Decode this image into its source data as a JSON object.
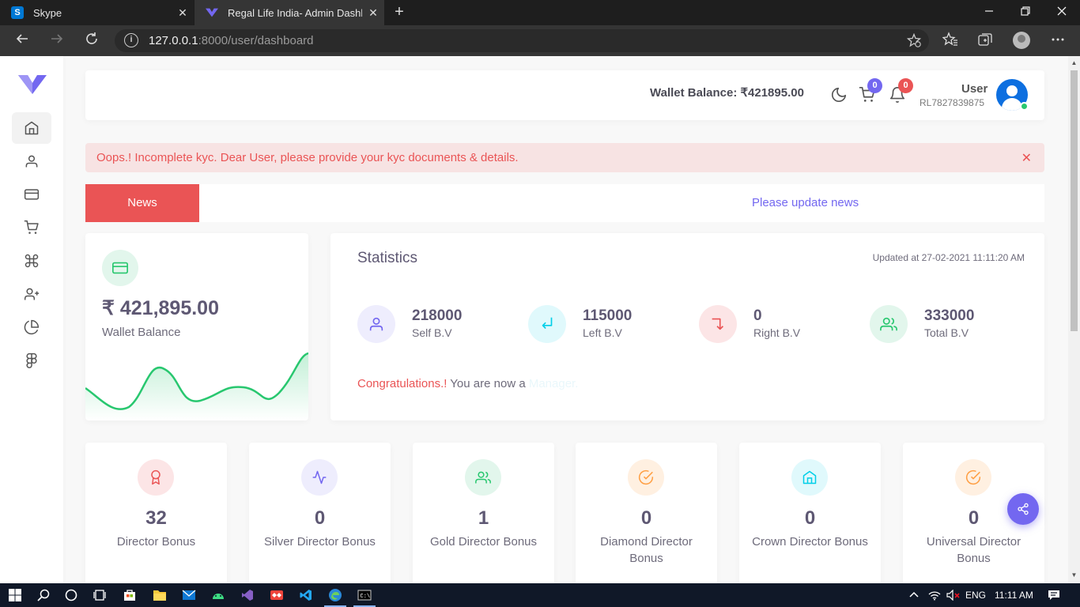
{
  "browser": {
    "tabs": [
      {
        "title": "Skype",
        "icon": "skype-icon",
        "color": "#0078d4"
      },
      {
        "title": "Regal Life India- Admin Dashboa",
        "icon": "vuexy-logo-icon",
        "color": "#7367f0"
      }
    ],
    "close_glyph": "✕",
    "new_tab_glyph": "+",
    "url_host": "127.0.0.1",
    "url_rest": ":8000/user/dashboard",
    "window_controls": [
      "minimize-icon",
      "restore-icon",
      "close-icon"
    ]
  },
  "sidebar": {
    "items": [
      "home-icon",
      "user-icon",
      "credit-card-icon",
      "cart-icon",
      "command-icon",
      "user-plus-icon",
      "pie-chart-icon",
      "figma-icon"
    ],
    "active_index": 0
  },
  "header": {
    "wallet_balance": "Wallet Balance: ₹421895.00",
    "cart_count": "0",
    "notification_count": "0",
    "user_name": "User",
    "user_id": "RL7827839875"
  },
  "alert": {
    "text": "Oops.! Incomplete kyc. Dear User, please provide your kyc documents & details.",
    "close": "✕"
  },
  "news": {
    "label": "News",
    "text": "Please update news"
  },
  "wallet_card": {
    "amount": "₹ 421,895.00",
    "label": "Wallet Balance"
  },
  "statistics": {
    "title": "Statistics",
    "updated": "Updated at 27-02-2021 11:11:20 AM",
    "items": [
      {
        "value": "218000",
        "label": "Self B.V",
        "icon": "user-icon"
      },
      {
        "value": "115000",
        "label": "Left B.V",
        "icon": "arrow-down-left-icon"
      },
      {
        "value": "0",
        "label": "Right B.V",
        "icon": "arrow-down-right-icon"
      },
      {
        "value": "333000",
        "label": "Total B.V",
        "icon": "users-icon"
      }
    ],
    "congrats_prefix": "Congratulations.!",
    "congrats_middle": " You are now a ",
    "congrats_rank": "Manager."
  },
  "bonuses": [
    {
      "value": "32",
      "label": "Director Bonus",
      "icon": "award-icon"
    },
    {
      "value": "0",
      "label": "Silver Director Bonus",
      "icon": "activity-icon"
    },
    {
      "value": "1",
      "label": "Gold Director Bonus",
      "icon": "users-icon"
    },
    {
      "value": "0",
      "label": "Diamond Director Bonus",
      "icon": "check-circle-icon"
    },
    {
      "value": "0",
      "label": "Crown Director Bonus",
      "icon": "home-icon"
    },
    {
      "value": "0",
      "label": "Universal Director Bonus",
      "icon": "check-circle-icon"
    }
  ],
  "taskbar": {
    "language": "ENG",
    "time": "11:11 AM"
  },
  "colors": {
    "primary": "#7367f0",
    "danger": "#ea5455",
    "success": "#28c76f",
    "warning": "#ff9f43",
    "info": "#00cfe8"
  }
}
